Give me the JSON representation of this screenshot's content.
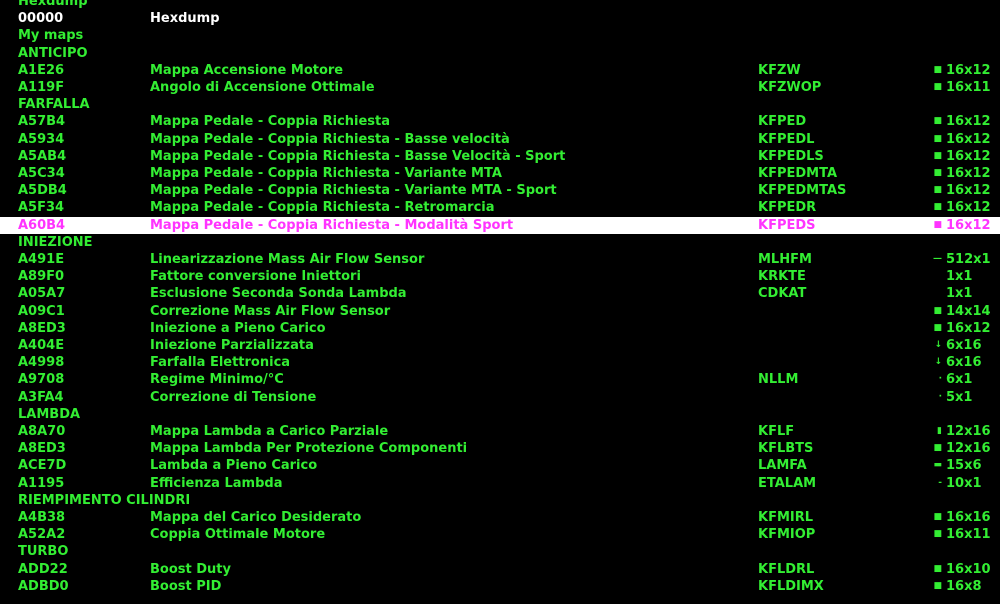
{
  "colors": {
    "text": "#33ee33",
    "white": "#ffffff",
    "selected_text": "#ff33ff",
    "selected_bg": "#ffffff",
    "background": "#000000"
  },
  "rows": [
    {
      "kind": "header",
      "label": "Hexdump"
    },
    {
      "kind": "map",
      "white": true,
      "addr": "00000",
      "desc": "Hexdump",
      "id": "",
      "glyph": "",
      "size": ""
    },
    {
      "kind": "header",
      "label": "My maps"
    },
    {
      "kind": "header",
      "label": "ANTICIPO"
    },
    {
      "kind": "map",
      "addr": "A1E26",
      "desc": "Mappa Accensione Motore",
      "id": "KFZW",
      "glyph": "■",
      "size": "16x12"
    },
    {
      "kind": "map",
      "addr": "A119F",
      "desc": "Angolo di Accensione Ottimale",
      "id": "KFZWOP",
      "glyph": "■",
      "size": "16x11"
    },
    {
      "kind": "header",
      "label": "FARFALLA"
    },
    {
      "kind": "map",
      "addr": "A57B4",
      "desc": "Mappa Pedale - Coppia Richiesta",
      "id": "KFPED",
      "glyph": "■",
      "size": "16x12"
    },
    {
      "kind": "map",
      "addr": "A5934",
      "desc": "Mappa Pedale - Coppia Richiesta - Basse velocità",
      "id": "KFPEDL",
      "glyph": "■",
      "size": "16x12"
    },
    {
      "kind": "map",
      "addr": "A5AB4",
      "desc": "Mappa Pedale - Coppia Richiesta - Basse Velocità - Sport",
      "id": "KFPEDLS",
      "glyph": "■",
      "size": "16x12"
    },
    {
      "kind": "map",
      "addr": "A5C34",
      "desc": "Mappa Pedale - Coppia Richiesta - Variante MTA",
      "id": "KFPEDMTA",
      "glyph": "■",
      "size": "16x12"
    },
    {
      "kind": "map",
      "addr": "A5DB4",
      "desc": "Mappa Pedale - Coppia Richiesta - Variante MTA - Sport",
      "id": "KFPEDMTAS",
      "glyph": "■",
      "size": "16x12"
    },
    {
      "kind": "map",
      "addr": "A5F34",
      "desc": "Mappa Pedale - Coppia Richiesta - Retromarcia",
      "id": "KFPEDR",
      "glyph": "■",
      "size": "16x12"
    },
    {
      "kind": "map",
      "selected": true,
      "addr": "A60B4",
      "desc": "Mappa Pedale - Coppia Richiesta - Modalità Sport",
      "id": "KFPEDS",
      "glyph": "■",
      "size": "16x12"
    },
    {
      "kind": "header",
      "label": "INIEZIONE"
    },
    {
      "kind": "map",
      "addr": "A491E",
      "desc": "Linearizzazione Mass Air Flow Sensor",
      "id": "MLHFM",
      "glyph": "—",
      "size": "512x1"
    },
    {
      "kind": "map",
      "addr": "A89F0",
      "desc": "Fattore conversione Iniettori",
      "id": "KRKTE",
      "glyph": "",
      "size": "1x1"
    },
    {
      "kind": "map",
      "addr": "A05A7",
      "desc": "Esclusione Seconda Sonda Lambda",
      "id": "CDKAT",
      "glyph": "",
      "size": "1x1"
    },
    {
      "kind": "map",
      "addr": "A09C1",
      "desc": "Correzione Mass Air Flow Sensor",
      "id": "",
      "glyph": "■",
      "size": "14x14"
    },
    {
      "kind": "map",
      "addr": "A8ED3",
      "desc": "Iniezione a Pieno Carico",
      "id": "",
      "glyph": "■",
      "size": "16x12"
    },
    {
      "kind": "map",
      "addr": "A404E",
      "desc": "Iniezione Parzializzata",
      "id": "",
      "glyph": "↓",
      "size": "6x16"
    },
    {
      "kind": "map",
      "addr": "A4998",
      "desc": "Farfalla Elettronica",
      "id": "",
      "glyph": "↓",
      "size": "6x16"
    },
    {
      "kind": "map",
      "addr": "A9708",
      "desc": "Regime Minimo/°C",
      "id": "NLLM",
      "glyph": "·",
      "size": "6x1"
    },
    {
      "kind": "map",
      "addr": "A3FA4",
      "desc": "Correzione di Tensione",
      "id": "",
      "glyph": "·",
      "size": "5x1"
    },
    {
      "kind": "header",
      "label": "LAMBDA"
    },
    {
      "kind": "map",
      "addr": "A8A70",
      "desc": "Mappa Lambda a Carico Parziale",
      "id": "KFLF",
      "glyph": "▮",
      "size": "12x16"
    },
    {
      "kind": "map",
      "addr": "A8ED3",
      "desc": "Mappa Lambda Per Protezione Componenti",
      "id": "KFLBTS",
      "glyph": "■",
      "size": "12x16"
    },
    {
      "kind": "map",
      "addr": "ACE7D",
      "desc": "Lambda a Pieno Carico",
      "id": "LAMFA",
      "glyph": "▬",
      "size": "15x6"
    },
    {
      "kind": "map",
      "addr": "A1195",
      "desc": "Efficienza Lambda",
      "id": "ETALAM",
      "glyph": "-",
      "size": "10x1"
    },
    {
      "kind": "header",
      "label": "RIEMPIMENTO CILINDRI"
    },
    {
      "kind": "map",
      "addr": "A4B38",
      "desc": "Mappa del Carico Desiderato",
      "id": "KFMIRL",
      "glyph": "■",
      "size": "16x16"
    },
    {
      "kind": "map",
      "addr": "A52A2",
      "desc": "Coppia Ottimale Motore",
      "id": "KFMIOP",
      "glyph": "■",
      "size": "16x11"
    },
    {
      "kind": "header",
      "label": "TURBO"
    },
    {
      "kind": "map",
      "addr": "ADD22",
      "desc": "Boost Duty",
      "id": "KFLDRL",
      "glyph": "■",
      "size": "16x10"
    },
    {
      "kind": "map",
      "addr": "ADBD0",
      "desc": "Boost PID",
      "id": "KFLDIMX",
      "glyph": "■",
      "size": "16x8"
    }
  ]
}
